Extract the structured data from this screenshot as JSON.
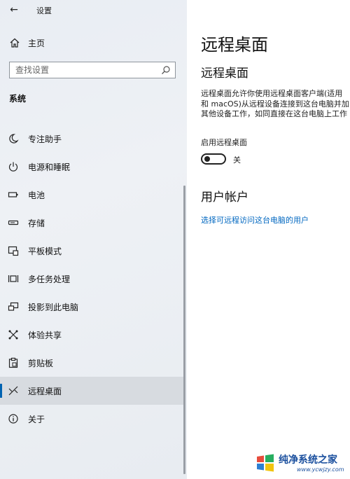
{
  "window": {
    "back": "←",
    "title": "设置"
  },
  "sidebar": {
    "home_label": "主页",
    "search_placeholder": "查找设置",
    "section_title": "系统",
    "items": [
      {
        "label": "专注助手",
        "icon": "moon-icon"
      },
      {
        "label": "电源和睡眠",
        "icon": "power-icon"
      },
      {
        "label": "电池",
        "icon": "battery-icon"
      },
      {
        "label": "存储",
        "icon": "storage-icon"
      },
      {
        "label": "平板模式",
        "icon": "tablet-mode-icon"
      },
      {
        "label": "多任务处理",
        "icon": "multitasking-icon"
      },
      {
        "label": "投影到此电脑",
        "icon": "project-icon"
      },
      {
        "label": "体验共享",
        "icon": "shared-experiences-icon"
      },
      {
        "label": "剪贴板",
        "icon": "clipboard-icon"
      },
      {
        "label": "远程桌面",
        "icon": "remote-desktop-icon",
        "active": true
      },
      {
        "label": "关于",
        "icon": "info-icon"
      }
    ],
    "accent_color": "#0063b1"
  },
  "main": {
    "page_title": "远程桌面",
    "sub_title": "远程桌面",
    "description_lines": [
      "远程桌面允许你使用远程桌面客户端(适用",
      "和 macOS)从远程设备连接到这台电脑并加",
      "其他设备工作，如同直接在这台电脑上工作"
    ],
    "toggle_label": "启用远程桌面",
    "toggle_state": "关",
    "toggle_on": false,
    "account_title": "用户帐户",
    "account_link": "选择可远程访问这台电脑的用户",
    "link_color": "#0067c0"
  },
  "watermark": {
    "text": "纯净系统之家",
    "url": "www.ycwjzy.com"
  }
}
